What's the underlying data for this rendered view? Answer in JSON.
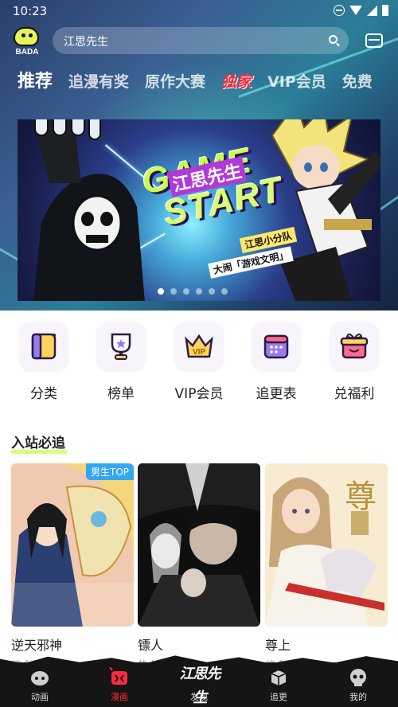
{
  "status_bar": {
    "time": "10:23"
  },
  "app": {
    "logo_text": "BADA"
  },
  "search": {
    "text": "江思先生"
  },
  "tabs": [
    {
      "label": "推荐",
      "state": "active"
    },
    {
      "label": "追漫有奖",
      "state": "normal"
    },
    {
      "label": "原作大赛",
      "state": "normal"
    },
    {
      "label": "独家",
      "state": "special"
    },
    {
      "label": "VIP会员",
      "state": "normal"
    },
    {
      "label": "免费",
      "state": "normal"
    }
  ],
  "banner": {
    "title_line1": "GAME",
    "title_line2": "START",
    "logo_text": "江思先生",
    "tag1": "江思小分队",
    "tag2": "大闹「游戏文明」",
    "dots_count": 6,
    "active_dot": 0
  },
  "quick_menu": [
    {
      "label": "分类",
      "icon": "category-icon"
    },
    {
      "label": "榜单",
      "icon": "trophy-icon"
    },
    {
      "label": "VIP会员",
      "icon": "vip-crown-icon"
    },
    {
      "label": "追更表",
      "icon": "calendar-icon"
    },
    {
      "label": "兑福利",
      "icon": "gift-icon"
    }
  ],
  "section": {
    "title": "入站必追"
  },
  "cards": [
    {
      "title": "逆天邪神",
      "tags": "综合",
      "badge": "男生TOP"
    },
    {
      "title": "镖人",
      "tags": "热血 历史",
      "badge": ""
    },
    {
      "title": "尊上",
      "tags": "综合",
      "badge": ""
    }
  ],
  "bottom_nav": [
    {
      "label": "动画",
      "icon": "anime-icon",
      "active": false
    },
    {
      "label": "漫画",
      "icon": "comic-icon",
      "active": true
    },
    {
      "label": "发现",
      "icon": "discover-logo-icon",
      "active": false
    },
    {
      "label": "追更",
      "icon": "follow-box-icon",
      "active": false
    },
    {
      "label": "我的",
      "icon": "profile-skull-icon",
      "active": false
    }
  ],
  "bottom_logo_text": "江思先生",
  "colors": {
    "accent_red": "#ff2a3d",
    "badge_blue": "#33a7f0",
    "highlight_green": "#c8ff4a",
    "nav_bg": "#151515"
  }
}
